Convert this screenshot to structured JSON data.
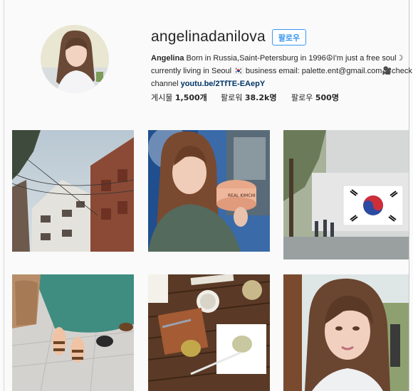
{
  "profile": {
    "username": "angelinadanilova",
    "follow_label": "팔로우",
    "bio": {
      "name": "Angelina",
      "line1": " Born in Russia,Saint-Petersburg in 1996☮︎I'm just a free soul☽",
      "line2": "currently living in Seoul 🇰🇷 business email: palette.ent@gmail.com🎥check my",
      "line3_prefix": "channel ",
      "link": "youtu.be/2TfTE-EAepY"
    },
    "stats": {
      "posts_label": "게시물 ",
      "posts_count": "1,500개",
      "followers_label": "팔로워 ",
      "followers_count": "38.2k명",
      "following_label": "팔로우 ",
      "following_count": "500명"
    }
  },
  "posts": [
    {
      "subject": "apartment-building-photo"
    },
    {
      "subject": "selfie-with-kimchi-can-photo",
      "label": "REAL KIMCHI"
    },
    {
      "subject": "korean-flag-wall-photo"
    },
    {
      "subject": "feet-sandals-photo"
    },
    {
      "subject": "cafe-table-photo"
    },
    {
      "subject": "portrait-photo"
    }
  ],
  "colors": {
    "accent": "#3897f0",
    "link": "#003569",
    "background": "#fafafa"
  }
}
